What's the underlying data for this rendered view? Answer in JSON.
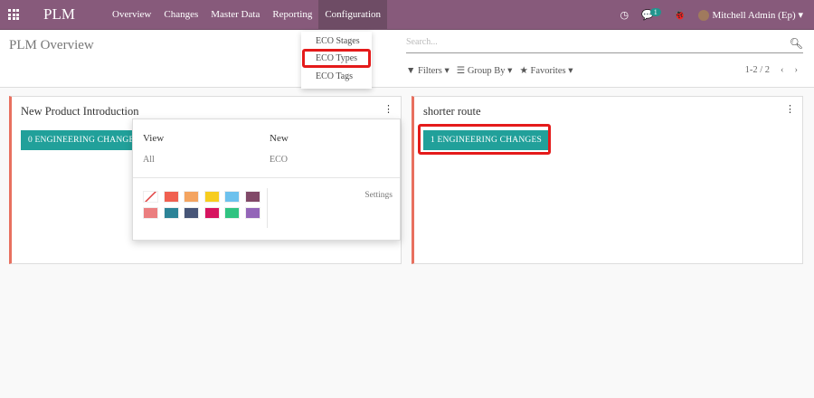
{
  "navbar": {
    "brand": "PLM",
    "menu": [
      "Overview",
      "Changes",
      "Master Data",
      "Reporting",
      "Configuration"
    ],
    "messages_badge": "1",
    "user": "Mitchell Admin (Ep)",
    "color": "#875A7B"
  },
  "config_menu": {
    "items": [
      "ECO Stages",
      "ECO Types",
      "ECO Tags"
    ],
    "highlighted": "ECO Types"
  },
  "control_panel": {
    "title": "PLM Overview",
    "search_placeholder": "Search...",
    "filters": "Filters",
    "group_by": "Group By",
    "favorites": "Favorites",
    "pager": "1-2 / 2"
  },
  "cards": [
    {
      "name": "New Product Introduction",
      "button": "0 ENGINEERING CHANGES"
    },
    {
      "name": "shorter route",
      "button": "1 ENGINEERING CHANGES",
      "highlighted": true
    }
  ],
  "card_dropdown": {
    "view_heading": "View",
    "view_all": "All",
    "new_heading": "New",
    "new_eco": "ECO",
    "settings": "Settings",
    "colors": [
      "none",
      "#F06050",
      "#F4A460",
      "#F7CD1F",
      "#6CC1ED",
      "#814968",
      "#EB7E7F",
      "#2C8397",
      "#475577",
      "#D6145F",
      "#30C381",
      "#9365B8"
    ]
  },
  "accent": "#21A09A"
}
